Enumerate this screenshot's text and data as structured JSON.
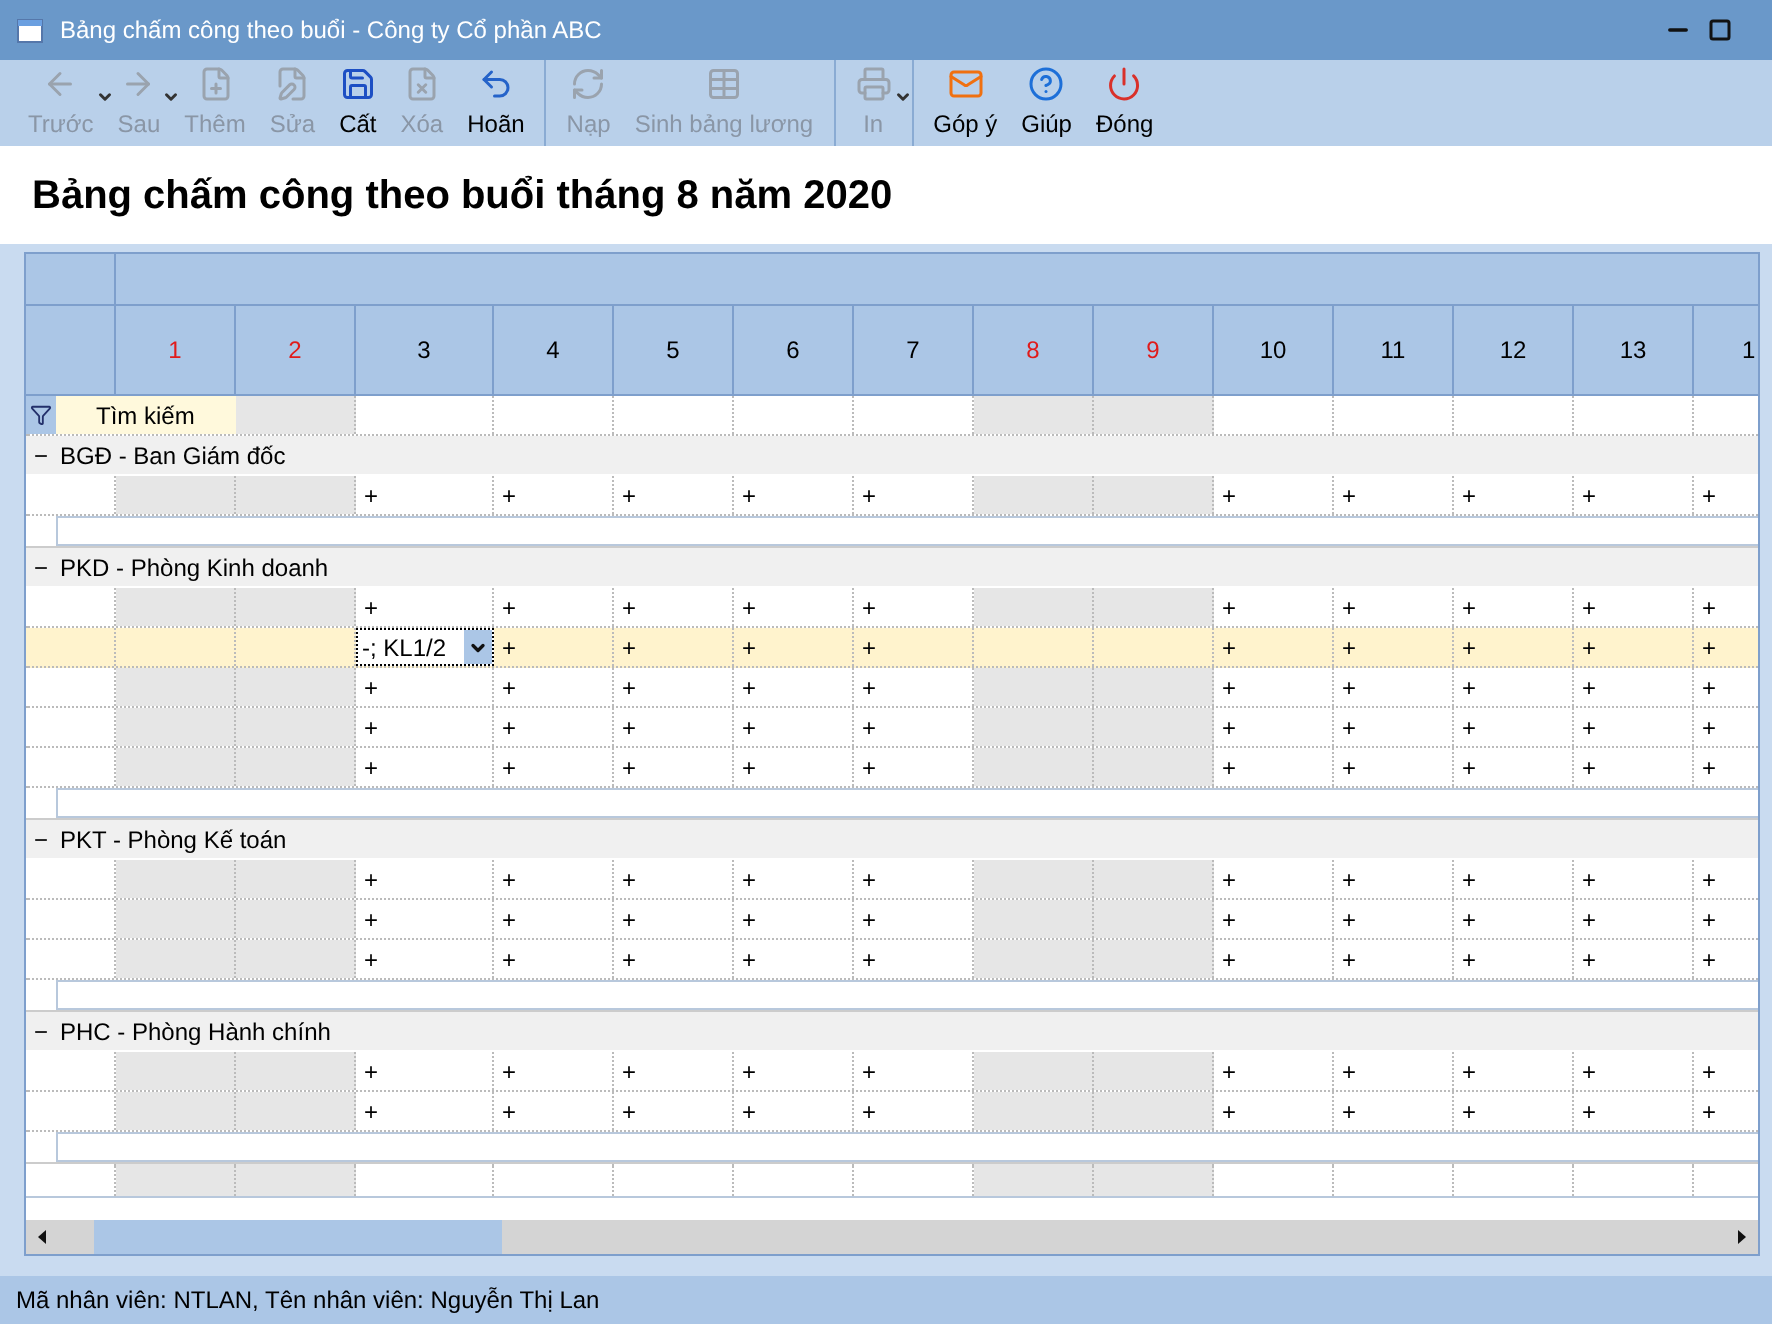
{
  "window": {
    "title": "Bảng chấm công theo buổi - Công ty Cổ phần ABC"
  },
  "toolbar": {
    "groups": [
      [
        {
          "label": "Trước",
          "disabled": true,
          "has_menu": true
        },
        {
          "label": "Sau",
          "disabled": true,
          "has_menu": true
        },
        {
          "label": "Thêm",
          "disabled": true,
          "has_menu": false
        },
        {
          "label": "Sửa",
          "disabled": true,
          "has_menu": false
        },
        {
          "label": "Cất",
          "disabled": false,
          "has_menu": false
        },
        {
          "label": "Xóa",
          "disabled": true,
          "has_menu": false
        },
        {
          "label": "Hoãn",
          "disabled": false,
          "has_menu": false
        }
      ],
      [
        {
          "label": "Nạp",
          "disabled": true,
          "has_menu": false
        },
        {
          "label": "Sinh bảng lương",
          "disabled": true,
          "has_menu": false
        }
      ],
      [
        {
          "label": "In",
          "disabled": true,
          "has_menu": true
        }
      ],
      [
        {
          "label": "Góp ý",
          "disabled": false,
          "has_menu": false
        },
        {
          "label": "Giúp",
          "disabled": false,
          "has_menu": false
        },
        {
          "label": "Đóng",
          "disabled": false,
          "has_menu": false
        }
      ]
    ]
  },
  "heading": "Bảng chấm công theo buổi tháng 8 năm 2020",
  "grid": {
    "days": [
      {
        "label": "1",
        "weekend": true
      },
      {
        "label": "2",
        "weekend": true
      },
      {
        "label": "3",
        "weekend": false
      },
      {
        "label": "4",
        "weekend": false
      },
      {
        "label": "5",
        "weekend": false
      },
      {
        "label": "6",
        "weekend": false
      },
      {
        "label": "7",
        "weekend": false
      },
      {
        "label": "8",
        "weekend": true
      },
      {
        "label": "9",
        "weekend": true
      },
      {
        "label": "10",
        "weekend": false
      },
      {
        "label": "11",
        "weekend": false
      },
      {
        "label": "12",
        "weekend": false
      },
      {
        "label": "13",
        "weekend": false
      },
      {
        "label": "1",
        "weekend": false
      }
    ],
    "search_label": "Tìm kiếm",
    "groups": [
      {
        "title": "BGĐ - Ban Giám đốc",
        "toggle": "−",
        "rows": [
          {
            "selected": false,
            "marks": [
              "+",
              "+",
              "+",
              "+",
              "+",
              "+",
              "+",
              "+",
              "+",
              "+"
            ]
          }
        ]
      },
      {
        "title": "PKD - Phòng Kinh doanh",
        "toggle": "−",
        "rows": [
          {
            "selected": false,
            "marks": [
              "+",
              "+",
              "+",
              "+",
              "+",
              "+",
              "+",
              "+",
              "+",
              "+"
            ]
          },
          {
            "selected": true,
            "editing_first": true,
            "marks": [
              "-; KL1/2",
              "+",
              "+",
              "+",
              "+",
              "+",
              "+",
              "+",
              "+",
              "+"
            ]
          },
          {
            "selected": false,
            "marks": [
              "+",
              "+",
              "+",
              "+",
              "+",
              "+",
              "+",
              "+",
              "+",
              "+"
            ]
          },
          {
            "selected": false,
            "marks": [
              "+",
              "+",
              "+",
              "+",
              "+",
              "+",
              "+",
              "+",
              "+",
              "+"
            ]
          },
          {
            "selected": false,
            "marks": [
              "+",
              "+",
              "+",
              "+",
              "+",
              "+",
              "+",
              "+",
              "+",
              "+"
            ]
          }
        ]
      },
      {
        "title": "PKT - Phòng Kế toán",
        "toggle": "−",
        "rows": [
          {
            "selected": false,
            "marks": [
              "+",
              "+",
              "+",
              "+",
              "+",
              "+",
              "+",
              "+",
              "+",
              "+"
            ]
          },
          {
            "selected": false,
            "marks": [
              "+",
              "+",
              "+",
              "+",
              "+",
              "+",
              "+",
              "+",
              "+",
              "+"
            ]
          },
          {
            "selected": false,
            "marks": [
              "+",
              "+",
              "+",
              "+",
              "+",
              "+",
              "+",
              "+",
              "+",
              "+"
            ]
          }
        ]
      },
      {
        "title": "PHC - Phòng Hành chính",
        "toggle": "−",
        "rows": [
          {
            "selected": false,
            "marks": [
              "+",
              "+",
              "+",
              "+",
              "+",
              "+",
              "+",
              "+",
              "+",
              "+"
            ]
          },
          {
            "selected": false,
            "marks": [
              "+",
              "+",
              "+",
              "+",
              "+",
              "+",
              "+",
              "+",
              "+",
              "+"
            ]
          }
        ]
      }
    ]
  },
  "status_bar": "Mã nhân viên: NTLAN, Tên nhân viên: Nguyễn Thị Lan"
}
